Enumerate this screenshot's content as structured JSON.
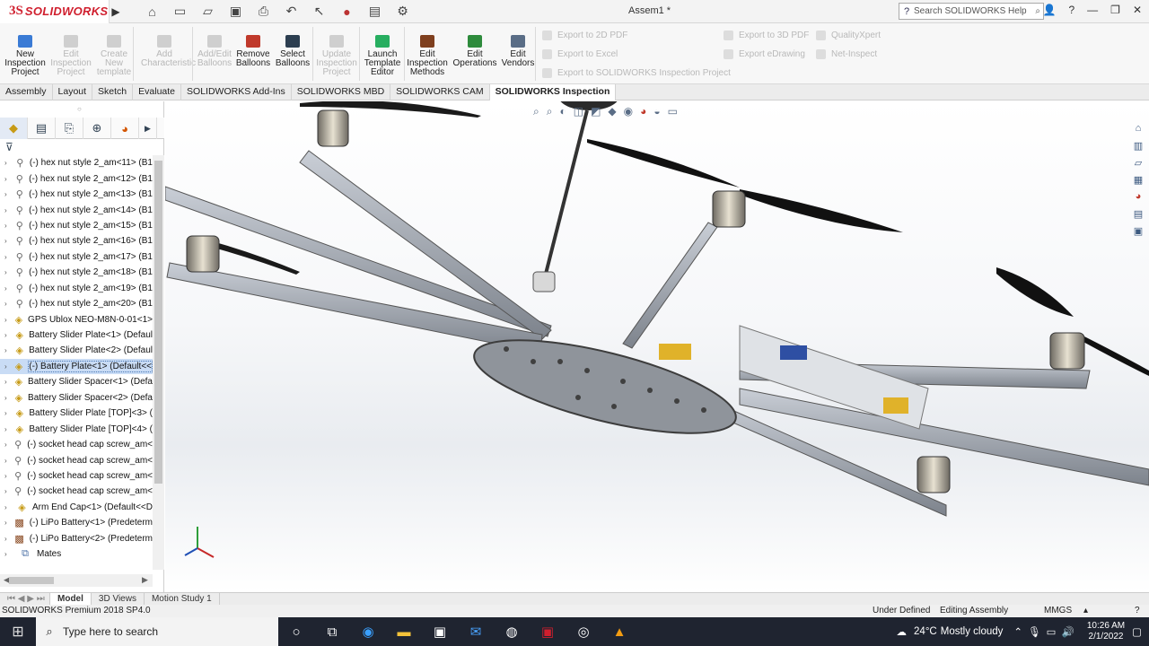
{
  "app": {
    "logo_prefix": "3S",
    "logo_name": "SOLIDWORKS",
    "document_title": "Assem1 *",
    "search_placeholder": "Search SOLIDWORKS Help"
  },
  "ribbon": {
    "buttons": [
      {
        "label": "New Inspection Project",
        "enabled": true,
        "color": "#3a7bd5"
      },
      {
        "label": "Edit Inspection Project",
        "enabled": false,
        "color": "#cfcfcf"
      },
      {
        "label": "Create New template",
        "enabled": false,
        "color": "#cfcfcf"
      },
      {
        "label": "Add Characteristic",
        "enabled": false,
        "color": "#cfcfcf"
      },
      {
        "label": "Add/Edit Balloons",
        "enabled": false,
        "color": "#cfcfcf"
      },
      {
        "label": "Remove Balloons",
        "enabled": true,
        "color": "#c0392b"
      },
      {
        "label": "Select Balloons",
        "enabled": true,
        "color": "#2c3e50"
      },
      {
        "label": "Update Inspection Project",
        "enabled": false,
        "color": "#cfcfcf"
      },
      {
        "label": "Launch Template Editor",
        "enabled": true,
        "color": "#27ae60"
      },
      {
        "label": "Edit Inspection Methods",
        "enabled": true,
        "color": "#7f3f1e"
      },
      {
        "label": "Edit Operations",
        "enabled": true,
        "color": "#2e8b3c"
      },
      {
        "label": "Edit Vendors",
        "enabled": true,
        "color": "#5a6d86"
      }
    ],
    "exports_col1": [
      "Export to 2D PDF",
      "Export to Excel",
      "Export to SOLIDWORKS Inspection Project"
    ],
    "exports_col2": [
      "Export to 3D PDF",
      "Export eDrawing"
    ],
    "exports_col3": [
      "QualityXpert",
      "Net-Inspect"
    ]
  },
  "tabs": [
    {
      "label": "Assembly",
      "active": false
    },
    {
      "label": "Layout",
      "active": false
    },
    {
      "label": "Sketch",
      "active": false
    },
    {
      "label": "Evaluate",
      "active": false
    },
    {
      "label": "SOLIDWORKS Add-Ins",
      "active": false
    },
    {
      "label": "SOLIDWORKS MBD",
      "active": false
    },
    {
      "label": "SOLIDWORKS CAM",
      "active": false
    },
    {
      "label": "SOLIDWORKS Inspection",
      "active": true
    }
  ],
  "tree": [
    {
      "label": "(-) hex nut style 2_am<11> (B1",
      "icon": "bolt",
      "selected": false
    },
    {
      "label": "(-) hex nut style 2_am<12> (B1",
      "icon": "bolt",
      "selected": false
    },
    {
      "label": "(-) hex nut style 2_am<13> (B1",
      "icon": "bolt",
      "selected": false
    },
    {
      "label": "(-) hex nut style 2_am<14> (B1",
      "icon": "bolt",
      "selected": false
    },
    {
      "label": "(-) hex nut style 2_am<15> (B1",
      "icon": "bolt",
      "selected": false
    },
    {
      "label": "(-) hex nut style 2_am<16> (B1",
      "icon": "bolt",
      "selected": false
    },
    {
      "label": "(-) hex nut style 2_am<17> (B1",
      "icon": "bolt",
      "selected": false
    },
    {
      "label": "(-) hex nut style 2_am<18> (B1",
      "icon": "bolt",
      "selected": false
    },
    {
      "label": "(-) hex nut style 2_am<19> (B1",
      "icon": "bolt",
      "selected": false
    },
    {
      "label": "(-) hex nut style 2_am<20> (B1",
      "icon": "bolt",
      "selected": false
    },
    {
      "label": "GPS Ublox NEO-M8N-0-01<1>",
      "icon": "part",
      "selected": false
    },
    {
      "label": "Battery Slider Plate<1> (Defaul",
      "icon": "part",
      "selected": false
    },
    {
      "label": "Battery Slider Plate<2> (Defaul",
      "icon": "part",
      "selected": false
    },
    {
      "label": "(-) Battery Plate<1> (Default<<",
      "icon": "part",
      "selected": true
    },
    {
      "label": "Battery Slider Spacer<1> (Defa",
      "icon": "part",
      "selected": false
    },
    {
      "label": "Battery Slider Spacer<2> (Defa",
      "icon": "part",
      "selected": false
    },
    {
      "label": "Battery Slider Plate [TOP]<3> (",
      "icon": "part",
      "selected": false
    },
    {
      "label": "Battery Slider Plate [TOP]<4> (",
      "icon": "part",
      "selected": false
    },
    {
      "label": "(-) socket head cap screw_am<",
      "icon": "bolt",
      "selected": false
    },
    {
      "label": "(-) socket head cap screw_am<",
      "icon": "bolt",
      "selected": false
    },
    {
      "label": "(-) socket head cap screw_am<",
      "icon": "bolt",
      "selected": false
    },
    {
      "label": "(-) socket head cap screw_am<",
      "icon": "bolt",
      "selected": false
    },
    {
      "label": "Arm End Cap<1> (Default<<D",
      "icon": "part",
      "selected": false
    },
    {
      "label": "(-) LiPo Battery<1> (Predeterm",
      "icon": "asm",
      "selected": false
    },
    {
      "label": "(-) LiPo Battery<2> (Predeterm",
      "icon": "asm",
      "selected": false
    },
    {
      "label": "Mates",
      "icon": "mates",
      "selected": false
    }
  ],
  "bottom_tabs": [
    {
      "label": "Model",
      "active": true
    },
    {
      "label": "3D Views",
      "active": false
    },
    {
      "label": "Motion Study 1",
      "active": false
    }
  ],
  "status": {
    "product": "SOLIDWORKS Premium 2018 SP4.0",
    "state": "Under Defined",
    "mode": "Editing Assembly",
    "units": "MMGS"
  },
  "taskbar": {
    "search_placeholder": "Type here to search",
    "weather_temp": "24°C",
    "weather_text": "Mostly cloudy",
    "time": "10:26 AM",
    "date": "2/1/2022"
  },
  "icons": {
    "home": "home-icon",
    "new": "new-document-icon",
    "open": "open-folder-icon",
    "save": "save-icon",
    "print": "print-icon",
    "undo": "undo-icon",
    "select": "cursor-icon",
    "traffic": "rebuild-icon",
    "file_props": "file-properties-icon",
    "options": "gear-icon"
  }
}
